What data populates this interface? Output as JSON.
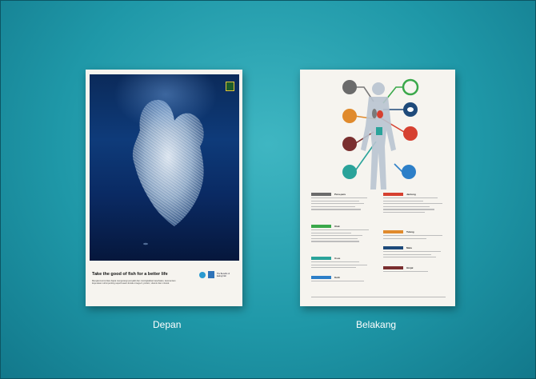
{
  "labels": {
    "front": "Depan",
    "back": "Belakang"
  },
  "front": {
    "title": "Take the good of fish for a better life",
    "body": "Mengkonsumsi ikan dapat mengurangi penyakit dan meningkatkan kesehatan, karena ikan kaya akan nutrisi penting seperti asam lemak omega-3, protein, vitamin dan mineral.",
    "logo_text": "The Benefits of Eating Fish"
  },
  "back": {
    "categories": [
      {
        "name": "Paru-paru",
        "color": "#6b6b6b"
      },
      {
        "name": "Jantung",
        "color": "#d64030"
      },
      {
        "name": "Otak",
        "color": "#3aa84a"
      },
      {
        "name": "Tulang",
        "color": "#e08a2c"
      },
      {
        "name": "Mata",
        "color": "#1e4a7a"
      },
      {
        "name": "Usus",
        "color": "#2aa39a"
      },
      {
        "name": "Ginjal",
        "color": "#7a2f2f"
      },
      {
        "name": "Kulit",
        "color": "#2d7fc8"
      }
    ]
  },
  "colors": {
    "bg": "#1f98a8",
    "poster": "#f6f4ef"
  }
}
